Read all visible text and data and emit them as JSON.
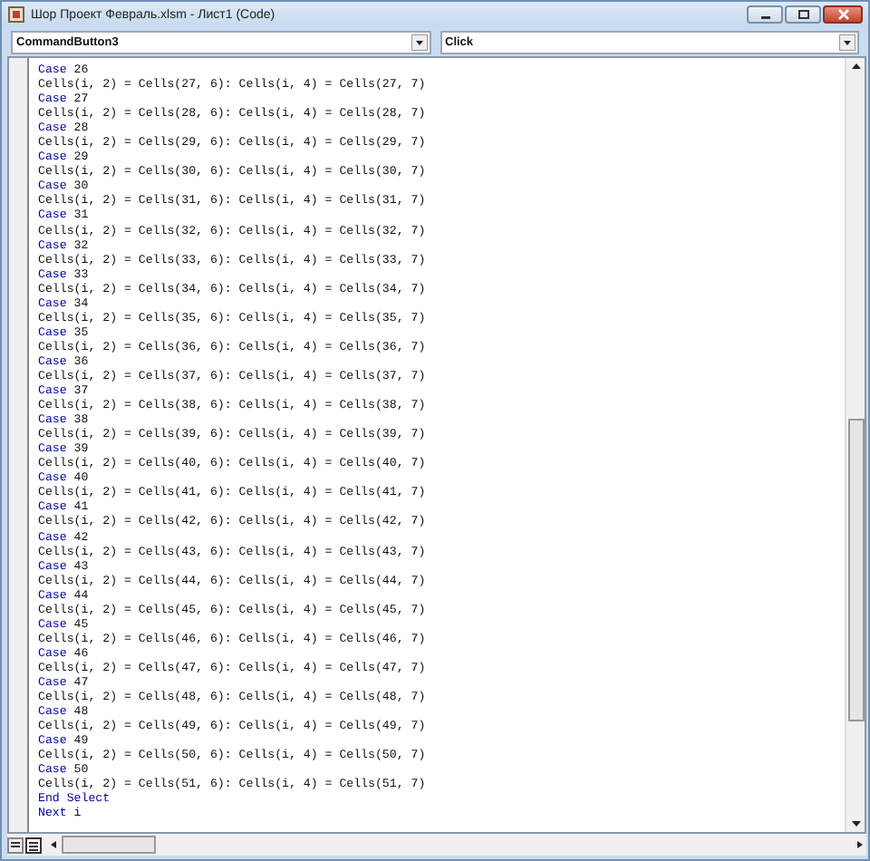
{
  "window": {
    "title": "Шор Проект Февраль.xlsm - Лист1 (Code)"
  },
  "object_dropdown": {
    "value": "CommandButton3"
  },
  "procedure_dropdown": {
    "value": "Click"
  },
  "code_lines": [
    {
      "keyword": "Case",
      "rest": "26"
    },
    {
      "rest": "Cells(i, 2) = Cells(27, 6): Cells(i, 4) = Cells(27, 7)"
    },
    {
      "keyword": "Case",
      "rest": "27"
    },
    {
      "rest": "Cells(i, 2) = Cells(28, 6): Cells(i, 4) = Cells(28, 7)"
    },
    {
      "keyword": "Case",
      "rest": "28"
    },
    {
      "rest": "Cells(i, 2) = Cells(29, 6): Cells(i, 4) = Cells(29, 7)"
    },
    {
      "keyword": "Case",
      "rest": "29"
    },
    {
      "rest": "Cells(i, 2) = Cells(30, 6): Cells(i, 4) = Cells(30, 7)"
    },
    {
      "keyword": "Case",
      "rest": "30"
    },
    {
      "rest": "Cells(i, 2) = Cells(31, 6): Cells(i, 4) = Cells(31, 7)"
    },
    {
      "keyword": "Case",
      "rest": "31"
    },
    {
      "rest": "Cells(i, 2) = Cells(32, 6): Cells(i, 4) = Cells(32, 7)"
    },
    {
      "keyword": "Case",
      "rest": "32"
    },
    {
      "rest": "Cells(i, 2) = Cells(33, 6): Cells(i, 4) = Cells(33, 7)"
    },
    {
      "keyword": "Case",
      "rest": "33"
    },
    {
      "rest": "Cells(i, 2) = Cells(34, 6): Cells(i, 4) = Cells(34, 7)"
    },
    {
      "keyword": "Case",
      "rest": "34"
    },
    {
      "rest": "Cells(i, 2) = Cells(35, 6): Cells(i, 4) = Cells(35, 7)"
    },
    {
      "keyword": "Case",
      "rest": "35"
    },
    {
      "rest": "Cells(i, 2) = Cells(36, 6): Cells(i, 4) = Cells(36, 7)"
    },
    {
      "keyword": "Case",
      "rest": "36"
    },
    {
      "rest": "Cells(i, 2) = Cells(37, 6): Cells(i, 4) = Cells(37, 7)"
    },
    {
      "keyword": "Case",
      "rest": "37"
    },
    {
      "rest": "Cells(i, 2) = Cells(38, 6): Cells(i, 4) = Cells(38, 7)"
    },
    {
      "keyword": "Case",
      "rest": "38"
    },
    {
      "rest": "Cells(i, 2) = Cells(39, 6): Cells(i, 4) = Cells(39, 7)"
    },
    {
      "keyword": "Case",
      "rest": "39"
    },
    {
      "rest": "Cells(i, 2) = Cells(40, 6): Cells(i, 4) = Cells(40, 7)"
    },
    {
      "keyword": "Case",
      "rest": "40"
    },
    {
      "rest": "Cells(i, 2) = Cells(41, 6): Cells(i, 4) = Cells(41, 7)"
    },
    {
      "keyword": "Case",
      "rest": "41"
    },
    {
      "rest": "Cells(i, 2) = Cells(42, 6): Cells(i, 4) = Cells(42, 7)"
    },
    {
      "keyword": "Case",
      "rest": "42"
    },
    {
      "rest": "Cells(i, 2) = Cells(43, 6): Cells(i, 4) = Cells(43, 7)"
    },
    {
      "keyword": "Case",
      "rest": "43"
    },
    {
      "rest": "Cells(i, 2) = Cells(44, 6): Cells(i, 4) = Cells(44, 7)"
    },
    {
      "keyword": "Case",
      "rest": "44"
    },
    {
      "rest": "Cells(i, 2) = Cells(45, 6): Cells(i, 4) = Cells(45, 7)"
    },
    {
      "keyword": "Case",
      "rest": "45"
    },
    {
      "rest": "Cells(i, 2) = Cells(46, 6): Cells(i, 4) = Cells(46, 7)"
    },
    {
      "keyword": "Case",
      "rest": "46"
    },
    {
      "rest": "Cells(i, 2) = Cells(47, 6): Cells(i, 4) = Cells(47, 7)"
    },
    {
      "keyword": "Case",
      "rest": "47"
    },
    {
      "rest": "Cells(i, 2) = Cells(48, 6): Cells(i, 4) = Cells(48, 7)"
    },
    {
      "keyword": "Case",
      "rest": "48"
    },
    {
      "rest": "Cells(i, 2) = Cells(49, 6): Cells(i, 4) = Cells(49, 7)"
    },
    {
      "keyword": "Case",
      "rest": "49"
    },
    {
      "rest": "Cells(i, 2) = Cells(50, 6): Cells(i, 4) = Cells(50, 7)"
    },
    {
      "keyword": "Case",
      "rest": "50"
    },
    {
      "rest": "Cells(i, 2) = Cells(51, 6): Cells(i, 4) = Cells(51, 7)"
    },
    {
      "keyword": "End Select"
    },
    {
      "keyword": "Next",
      "rest": "i"
    }
  ]
}
